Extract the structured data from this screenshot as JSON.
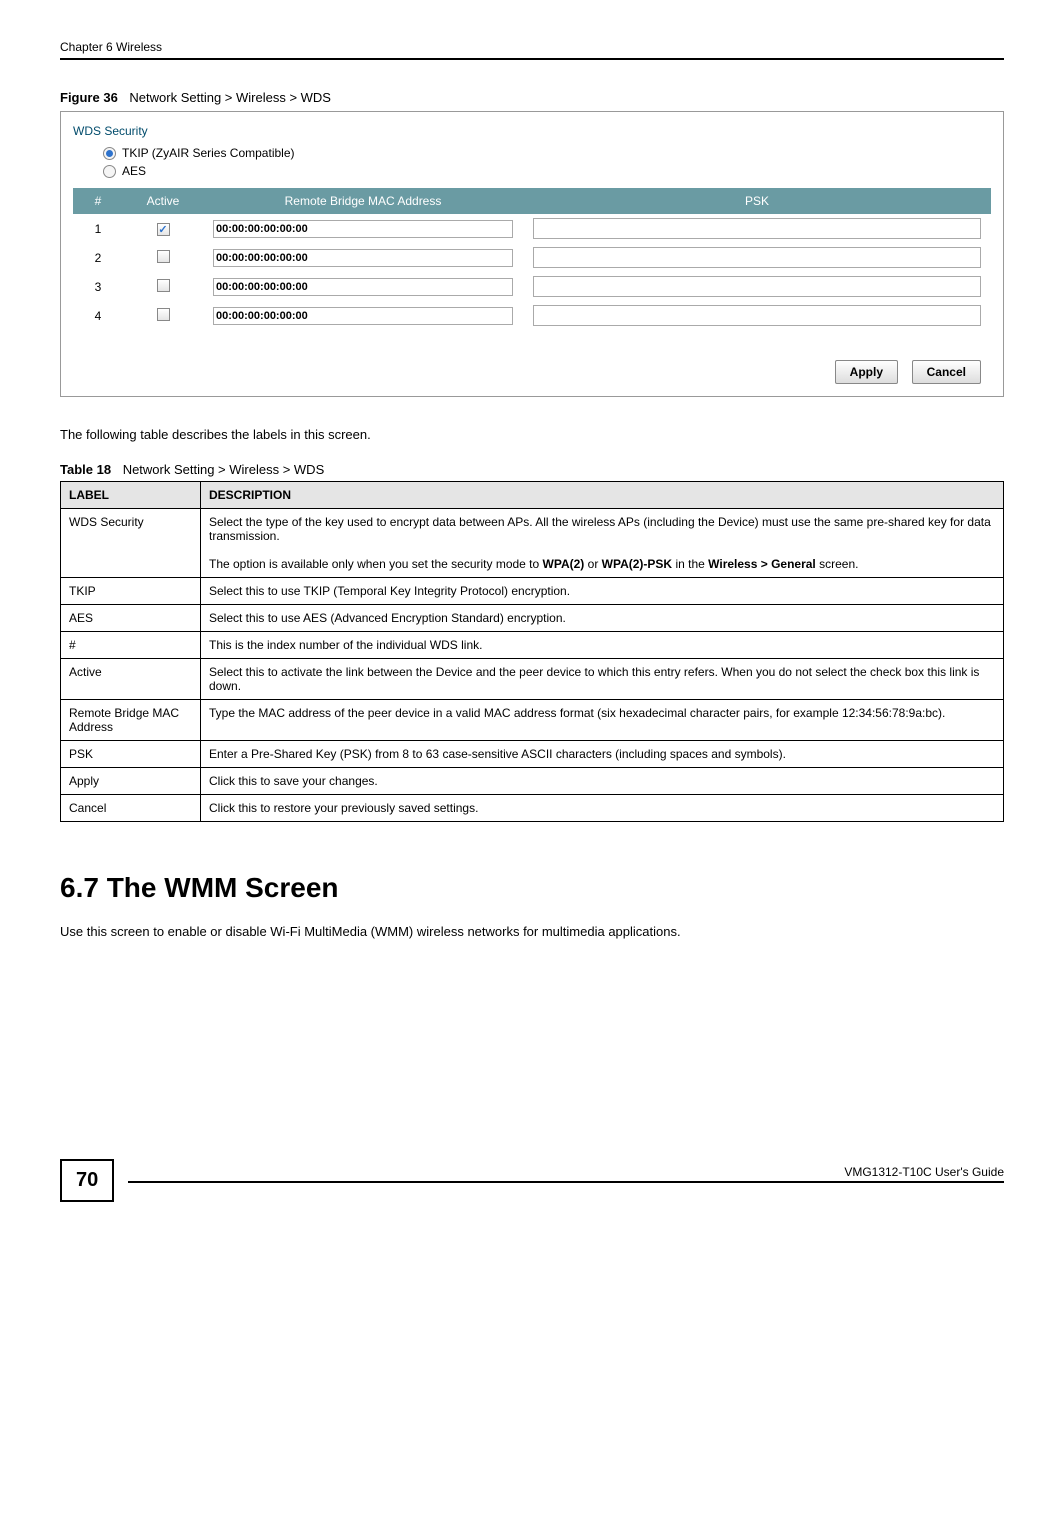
{
  "header": {
    "chapter": "Chapter 6 Wireless"
  },
  "figure": {
    "label": "Figure 36",
    "title": "Network Setting > Wireless > WDS"
  },
  "screenshot": {
    "wds_security_label": "WDS Security",
    "radio_tkip": "TKIP (ZyAIR Series Compatible)",
    "radio_aes": "AES",
    "table_headers": {
      "num": "#",
      "active": "Active",
      "mac": "Remote Bridge MAC Address",
      "psk": "PSK"
    },
    "rows": [
      {
        "num": "1",
        "checked": true,
        "mac": "00:00:00:00:00:00"
      },
      {
        "num": "2",
        "checked": false,
        "mac": "00:00:00:00:00:00"
      },
      {
        "num": "3",
        "checked": false,
        "mac": "00:00:00:00:00:00"
      },
      {
        "num": "4",
        "checked": false,
        "mac": "00:00:00:00:00:00"
      }
    ],
    "apply_btn": "Apply",
    "cancel_btn": "Cancel"
  },
  "intro_text": "The following table describes the labels in this screen.",
  "table": {
    "label": "Table 18",
    "title": "Network Setting > Wireless > WDS",
    "header_label": "LABEL",
    "header_desc": "DESCRIPTION",
    "rows": [
      {
        "label": "WDS Security",
        "desc_html": "Select the type of the key used to encrypt data between APs. All the wireless APs (including the Device) must use the same pre-shared key for data transmission.<br><br>The option is available only when you set the security mode to <b>WPA(2)</b> or <b>WPA(2)-PSK</b> in the <b>Wireless > General</b> screen."
      },
      {
        "label": "TKIP",
        "desc_html": "Select this to use TKIP (Temporal Key Integrity Protocol) encryption."
      },
      {
        "label": "AES",
        "desc_html": "Select this to use AES (Advanced Encryption Standard) encryption."
      },
      {
        "label": "#",
        "desc_html": "This is the index number of the individual WDS link."
      },
      {
        "label": "Active",
        "desc_html": "Select this to activate the link between the Device and the peer device to which this entry refers. When you do not select the check box this link is down."
      },
      {
        "label": "Remote Bridge MAC Address",
        "desc_html": "Type the MAC address of the peer device in a valid MAC address format (six hexadecimal character pairs, for example 12:34:56:78:9a:bc)."
      },
      {
        "label": "PSK",
        "desc_html": "Enter a Pre-Shared Key (PSK) from 8 to 63 case-sensitive ASCII characters (including spaces and symbols)."
      },
      {
        "label": "Apply",
        "desc_html": "Click this to save your changes."
      },
      {
        "label": "Cancel",
        "desc_html": "Click this to restore your previously saved settings."
      }
    ]
  },
  "section": {
    "heading": "6.7  The WMM Screen",
    "body": "Use this screen to enable or disable Wi-Fi MultiMedia (WMM) wireless networks for multimedia applications."
  },
  "footer": {
    "page": "70",
    "guide": "VMG1312-T10C User's Guide"
  }
}
